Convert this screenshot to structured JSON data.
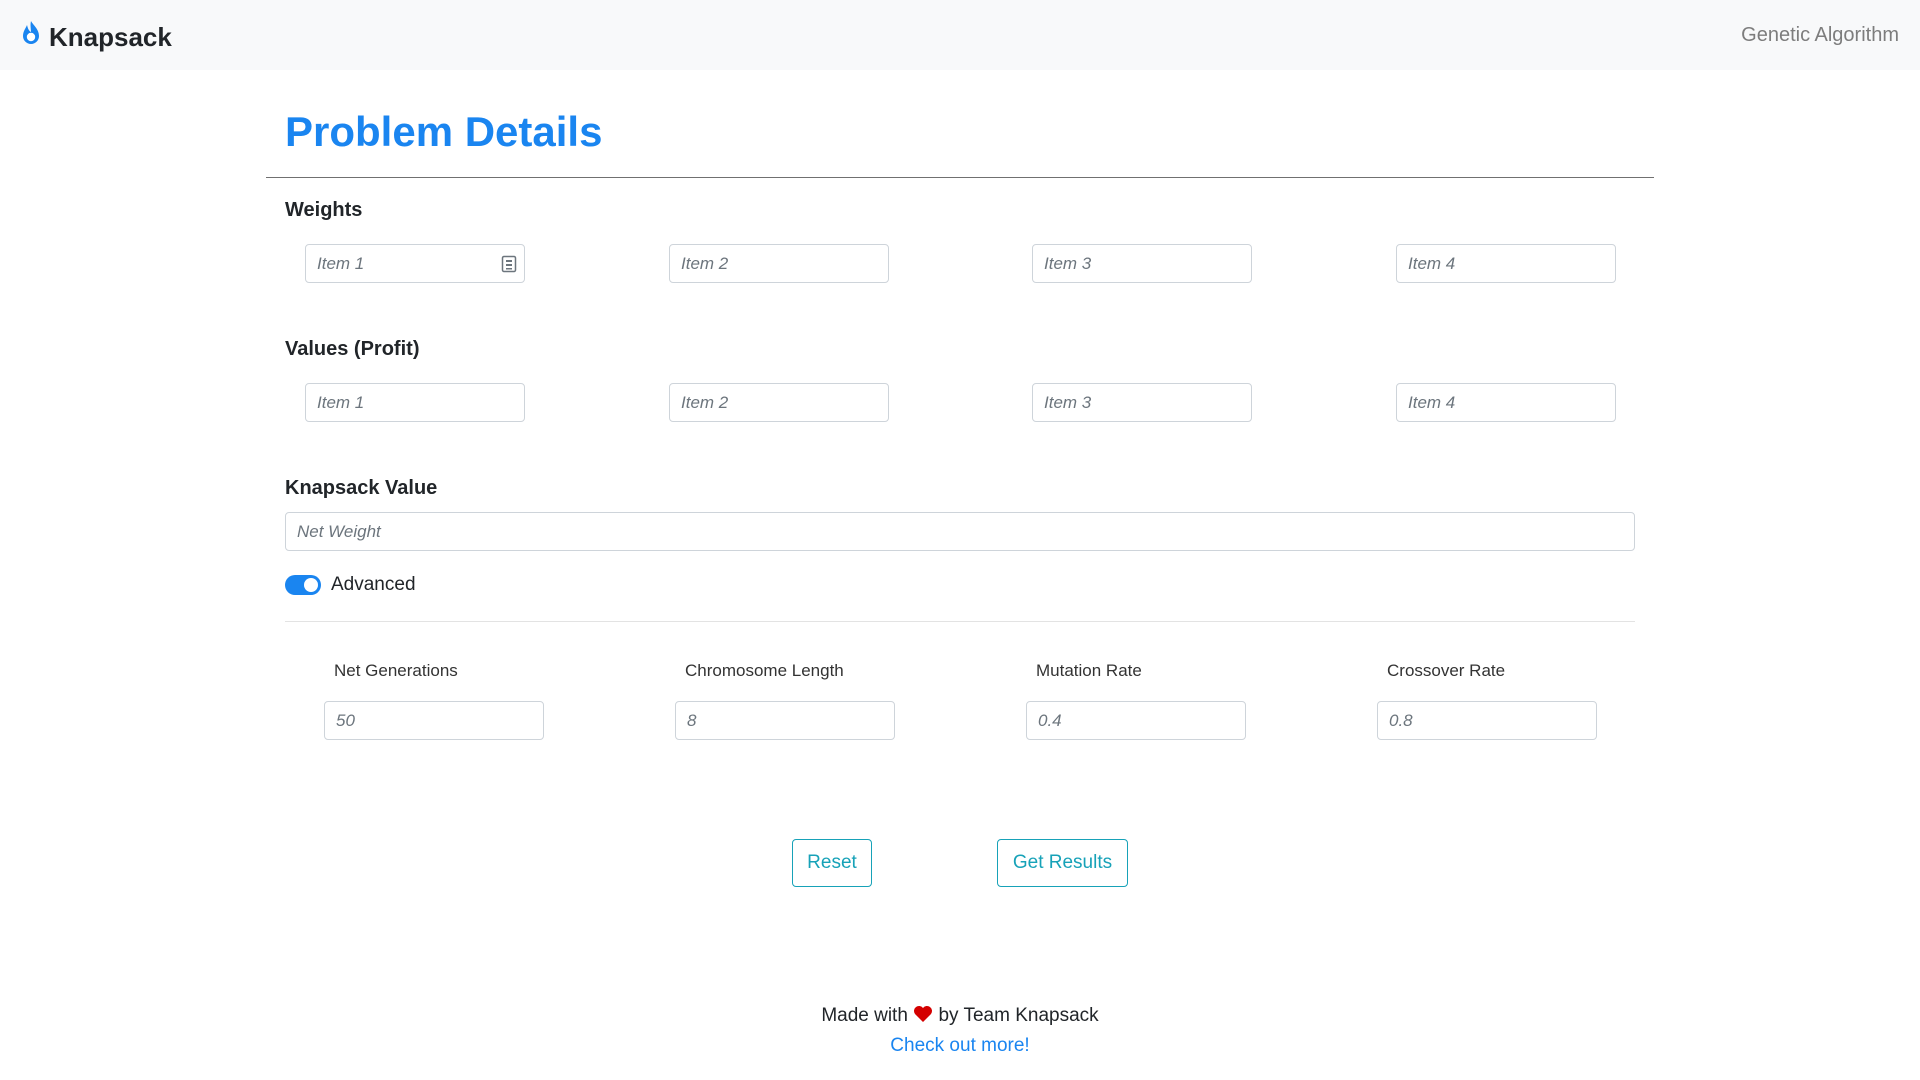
{
  "navbar": {
    "brand": "Knapsack",
    "link": "Genetic Algorithm"
  },
  "page_title": "Problem Details",
  "weights": {
    "label": "Weights",
    "items": [
      "Item 1",
      "Item 2",
      "Item 3",
      "Item 4"
    ]
  },
  "values": {
    "label": "Values (Profit)",
    "items": [
      "Item 1",
      "Item 2",
      "Item 3",
      "Item 4"
    ]
  },
  "knapsack": {
    "label": "Knapsack Value",
    "placeholder": "Net Weight"
  },
  "advanced": {
    "label": "Advanced",
    "enabled": true,
    "fields": [
      {
        "label": "Net Generations",
        "placeholder": "50"
      },
      {
        "label": "Chromosome Length",
        "placeholder": "8"
      },
      {
        "label": "Mutation Rate",
        "placeholder": "0.4"
      },
      {
        "label": "Crossover Rate",
        "placeholder": "0.8"
      }
    ]
  },
  "buttons": {
    "reset": "Reset",
    "get_results": "Get Results"
  },
  "footer": {
    "made_with": "Made with",
    "by": "by Team Knapsack",
    "link": "Check out more!"
  },
  "colors": {
    "brand": "#1a85f0",
    "button": "#17a2b8",
    "heart": "#d40000"
  },
  "icons": {
    "brand": "flame-icon",
    "weight_item_1": "calendar-icon",
    "heart": "heart-icon"
  }
}
